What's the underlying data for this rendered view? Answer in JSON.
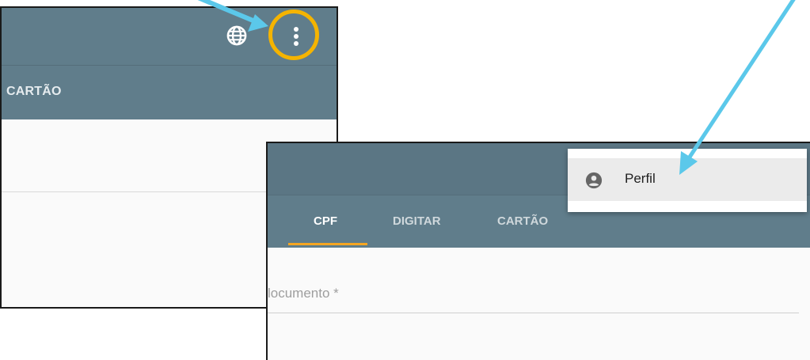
{
  "back_panel": {
    "toolbar": {
      "icons": [
        "globe-icon",
        "more-vert-icon"
      ]
    },
    "tab_partial_label": "CARTÃO"
  },
  "front_panel": {
    "tabs": [
      {
        "label": "CPF",
        "active": true
      },
      {
        "label": "DIGITAR",
        "active": false
      },
      {
        "label": "CARTÃO",
        "active": false
      }
    ],
    "document_field": {
      "label": "locumento *"
    }
  },
  "menu": {
    "items": [
      {
        "label": "Perfil",
        "icon": "account-circle-icon"
      }
    ]
  },
  "annotations": {
    "arrow_color": "#5bc8ea",
    "ring_color": "#f5b400"
  },
  "colors": {
    "toolbar": "#607d8b",
    "tab_indicator": "#f5a623"
  }
}
